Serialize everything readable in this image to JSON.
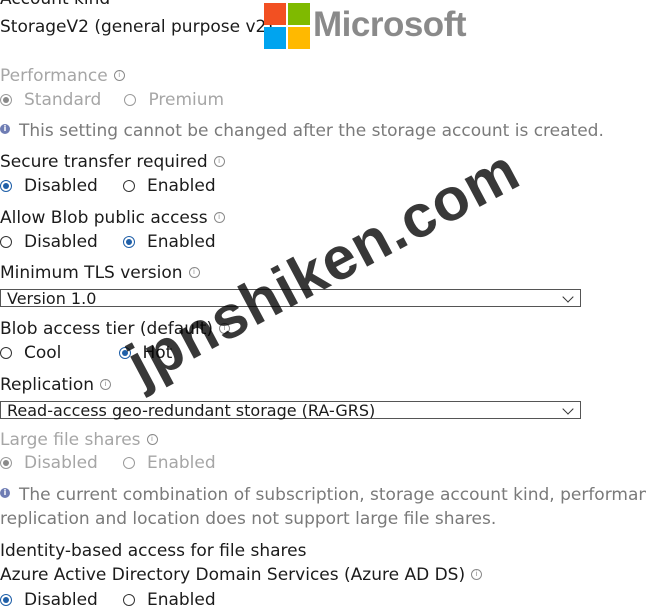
{
  "account_kind": {
    "label": "Account kind",
    "value": "StorageV2 (general purpose v2)"
  },
  "logo": {
    "text": "Microsoft",
    "colors": [
      "#f25022",
      "#7fba00",
      "#00a4ef",
      "#ffb900"
    ]
  },
  "performance": {
    "label": "Performance",
    "options": [
      "Standard",
      "Premium"
    ],
    "selected": "Standard",
    "note": "This setting cannot be changed after the storage account is created."
  },
  "secure_transfer": {
    "label": "Secure transfer required",
    "options": [
      "Disabled",
      "Enabled"
    ],
    "selected": "Disabled"
  },
  "blob_public_access": {
    "label": "Allow Blob public access",
    "options": [
      "Disabled",
      "Enabled"
    ],
    "selected": "Enabled"
  },
  "min_tls": {
    "label": "Minimum TLS version",
    "value": "Version 1.0"
  },
  "blob_tier": {
    "label": "Blob access tier (default)",
    "options": [
      "Cool",
      "Hot"
    ],
    "selected": "Hot"
  },
  "replication": {
    "label": "Replication",
    "value": "Read-access geo-redundant storage (RA-GRS)"
  },
  "large_file_shares": {
    "label": "Large file shares",
    "options": [
      "Disabled",
      "Enabled"
    ],
    "selected": "Disabled",
    "note_line1": "The current combination of subscription, storage account kind, performance",
    "note_line2": "replication and location does not support large file shares."
  },
  "identity_access": {
    "label": "Identity-based access for file shares",
    "sublabel": "Azure Active Directory Domain Services (Azure AD DS)",
    "options": [
      "Disabled",
      "Enabled"
    ],
    "selected": "Disabled"
  },
  "watermark": "jpnshiken.com",
  "colors": {
    "accent": "#1f5fa8",
    "info": "#2a4fae",
    "dim_text": "#a6a6a6"
  }
}
